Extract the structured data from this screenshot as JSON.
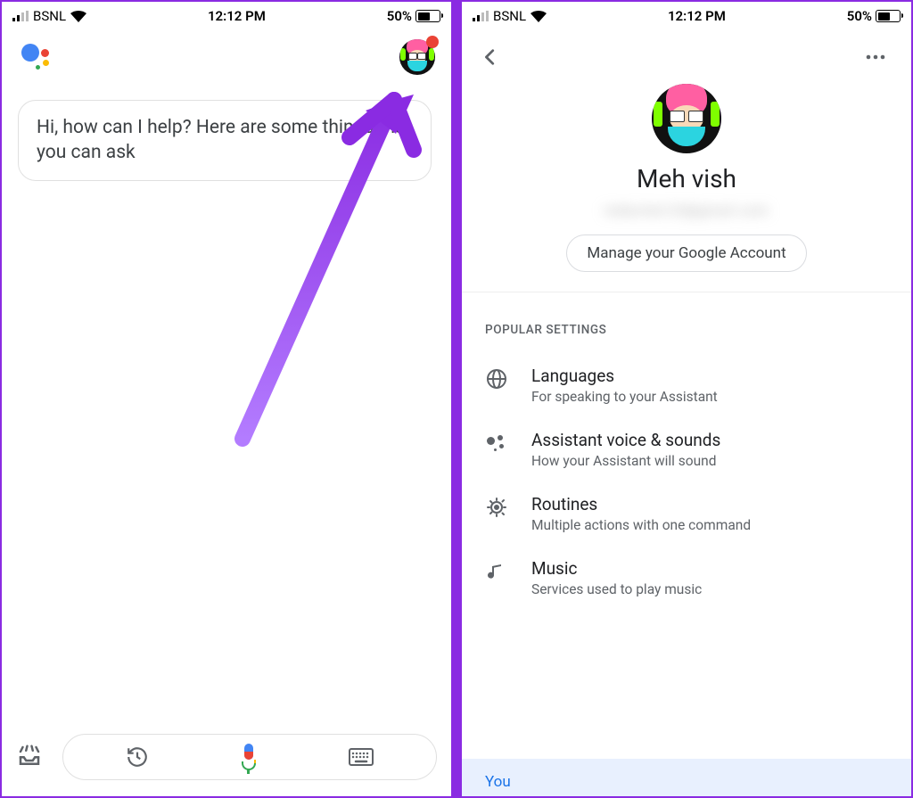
{
  "status": {
    "carrier": "BSNL",
    "time": "12:12 PM",
    "battery_pct": "50%"
  },
  "screen1": {
    "bubble_text": "Hi, how can I help? Here are some things that you can ask"
  },
  "screen2": {
    "profile": {
      "name": "Meh vish",
      "email_placeholder": "redacted-23@gmail.com",
      "manage_button": "Manage your Google Account"
    },
    "section_label": "POPULAR SETTINGS",
    "settings": [
      {
        "title": "Languages",
        "subtitle": "For speaking to your Assistant",
        "icon": "globe"
      },
      {
        "title": "Assistant voice & sounds",
        "subtitle": "How your Assistant will sound",
        "icon": "dots"
      },
      {
        "title": "Routines",
        "subtitle": "Multiple actions with one command",
        "icon": "routines"
      },
      {
        "title": "Music",
        "subtitle": "Services used to play music",
        "icon": "music"
      }
    ],
    "active_tab": "You"
  }
}
